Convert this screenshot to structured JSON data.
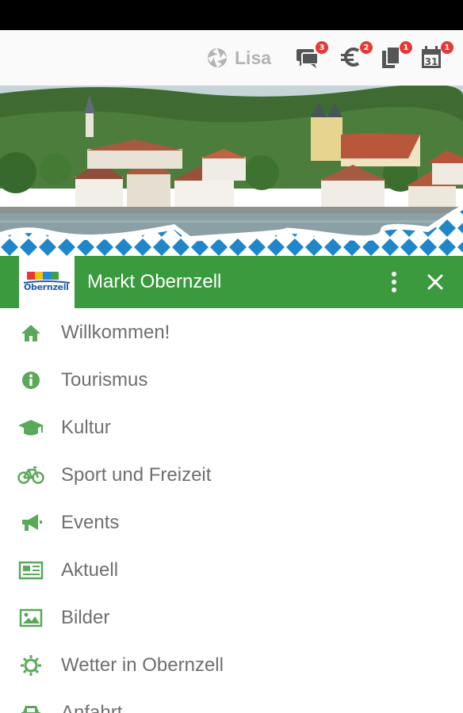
{
  "toolbar": {
    "user_name": "Lisa",
    "icons": [
      {
        "name": "chat-icon",
        "badge": "3"
      },
      {
        "name": "euro-icon",
        "badge": "2"
      },
      {
        "name": "documents-icon",
        "badge": "1"
      },
      {
        "name": "calendar-icon",
        "badge": "1",
        "day": "31"
      }
    ]
  },
  "header": {
    "logo_text": "Obernzell",
    "title": "Markt Obernzell"
  },
  "colors": {
    "brand_green": "#3b9a3e",
    "icon_green": "#5aa85a",
    "badge_red": "#e53935",
    "bavarian_blue": "#1f86c9"
  },
  "menu": {
    "items": [
      {
        "label": "Willkommen!",
        "icon": "home-icon"
      },
      {
        "label": "Tourismus",
        "icon": "info-icon"
      },
      {
        "label": "Kultur",
        "icon": "graduation-cap-icon"
      },
      {
        "label": "Sport und Freizeit",
        "icon": "bicycle-icon"
      },
      {
        "label": "Events",
        "icon": "megaphone-icon"
      },
      {
        "label": "Aktuell",
        "icon": "newspaper-icon"
      },
      {
        "label": "Bilder",
        "icon": "image-icon"
      },
      {
        "label": "Wetter in Obernzell",
        "icon": "sun-icon"
      },
      {
        "label": "Anfahrt",
        "icon": "car-icon"
      }
    ]
  }
}
